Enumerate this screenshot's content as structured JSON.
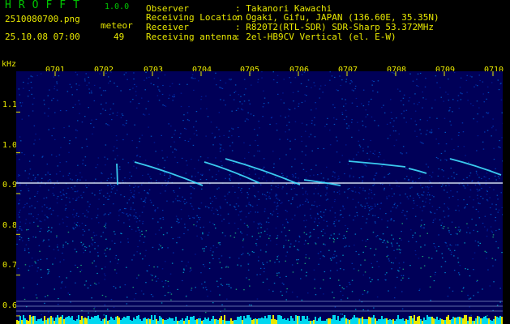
{
  "header": {
    "app_title": "HROFFT",
    "app_version": "1.0.0",
    "file_name": "2510080700.png",
    "date_time": "25.10.08 07:00",
    "type_label": "meteor",
    "count": "49",
    "info": [
      {
        "label": "Observer",
        "value": ": Takanori Kawachi"
      },
      {
        "label": "Receiving Location",
        "value": ": Ogaki, Gifu, JAPAN (136.60E, 35.35N)"
      },
      {
        "label": "Receiver",
        "value": ": R820T2(RTL-SDR) SDR-Sharp 53.372MHz"
      },
      {
        "label": "Receiving antenna",
        "value": ": 2el-HB9CV Vertical (el. E-W)"
      }
    ]
  },
  "axis": {
    "unit": "kHz",
    "y_ticks": [
      "1.1",
      "1.0",
      "0.9",
      "0.8",
      "0.7",
      "0.6"
    ],
    "y_values": [
      1.1,
      1.0,
      0.9,
      0.8,
      0.7,
      0.6
    ],
    "x_ticks": [
      "0701",
      "0702",
      "0703",
      "0704",
      "0705",
      "0706",
      "0707",
      "0708",
      "0709",
      "0710"
    ],
    "x_values": [
      1,
      2,
      3,
      4,
      5,
      6,
      7,
      8,
      9,
      10
    ],
    "ylim": [
      0.58,
      1.2
    ],
    "xlim": [
      0.2,
      10.2
    ]
  },
  "colors": {
    "label_yellow": "#e8e800",
    "title_green": "#00c800",
    "background_blue": "#000060",
    "echo_cyan": "#40e0ff",
    "carrier_white": "#e8f4ff"
  }
}
